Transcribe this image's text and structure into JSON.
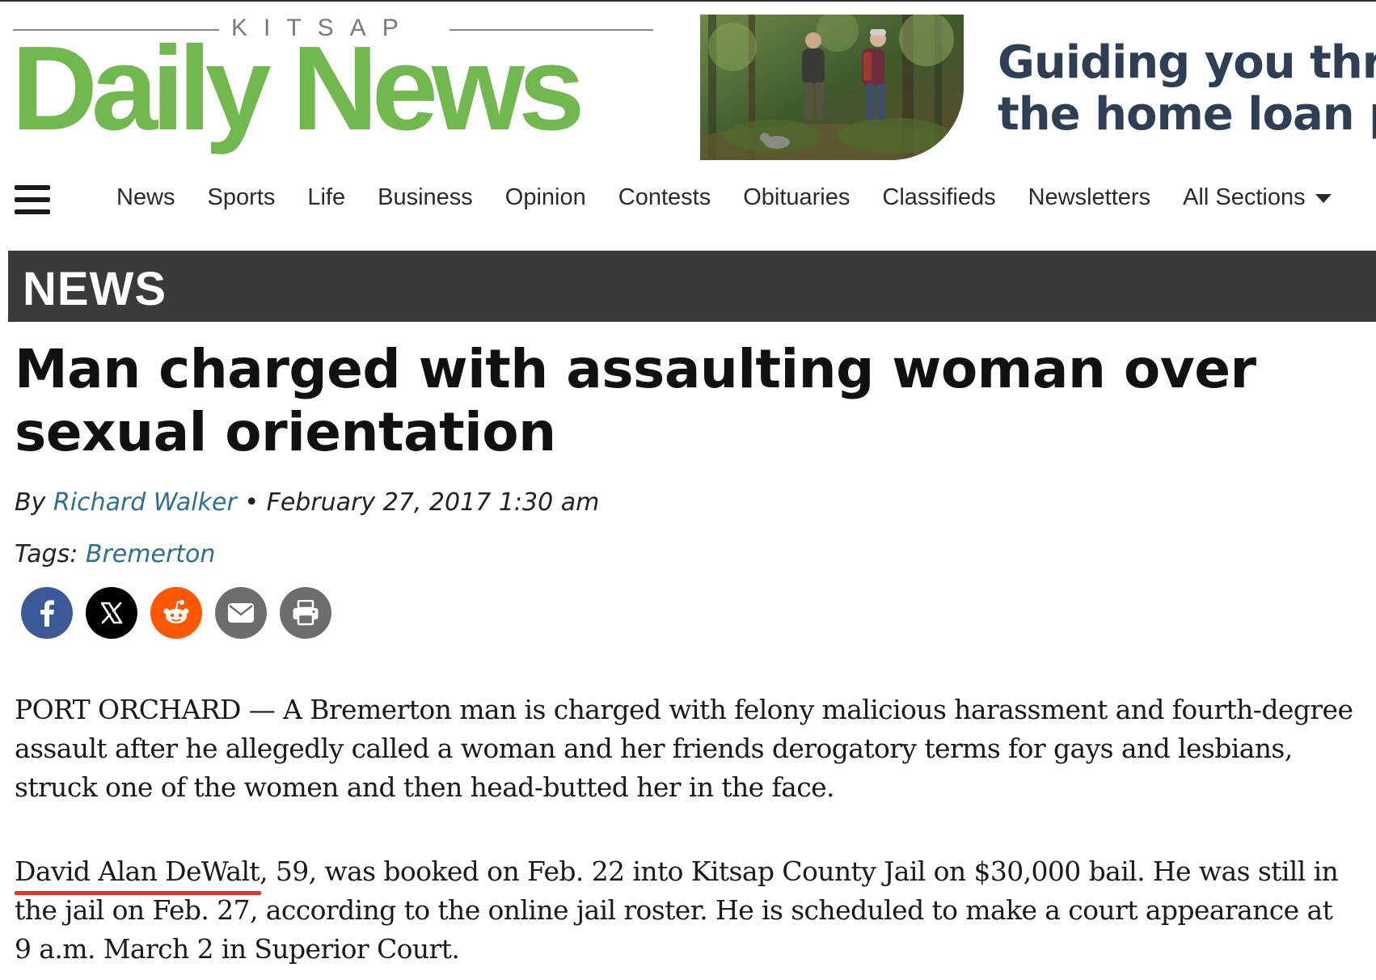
{
  "masthead": {
    "kitsap": "KITSAP",
    "title": "Daily News"
  },
  "ad": {
    "line1": "Guiding you thr",
    "line2": "the home loan p"
  },
  "nav": {
    "items": [
      "News",
      "Sports",
      "Life",
      "Business",
      "Opinion",
      "Contests",
      "Obituaries",
      "Classifieds",
      "Newsletters",
      "All Sections"
    ]
  },
  "section": {
    "label": "NEWS"
  },
  "article": {
    "headline": "Man charged with assaulting woman over sexual orientation",
    "by_prefix": "By",
    "author": "Richard Walker",
    "separator": "•",
    "date": "February 27, 2017 1:30 am",
    "tags_label": "Tags:",
    "tag": "Bremerton",
    "para1": "PORT ORCHARD — A Bremerton man is charged with felony malicious harassment and fourth-degree assault after he allegedly called a woman and her friends derogatory terms for gays and lesbians, struck one of the women and then head-butted her in the face.",
    "para2_name": "David Alan DeWalt",
    "para2_rest": ", 59, was booked on Feb. 22 into Kitsap County Jail on $30,000 bail. He was still in the jail on Feb. 27, according to the online jail roster. He is scheduled to make a court appearance at 9 a.m. March 2 in Superior Court."
  },
  "share": {
    "buttons": [
      {
        "name": "facebook",
        "color": "#3b5998"
      },
      {
        "name": "x",
        "color": "#000000"
      },
      {
        "name": "reddit",
        "color": "#ff5700"
      },
      {
        "name": "email",
        "color": "#6d6d6d"
      },
      {
        "name": "print",
        "color": "#6d6d6d"
      }
    ]
  },
  "colors": {
    "brand_green": "#71b84f",
    "section_bar": "#3a3a3a",
    "link": "#2e6f92",
    "highlight_underline": "#e2352b"
  }
}
